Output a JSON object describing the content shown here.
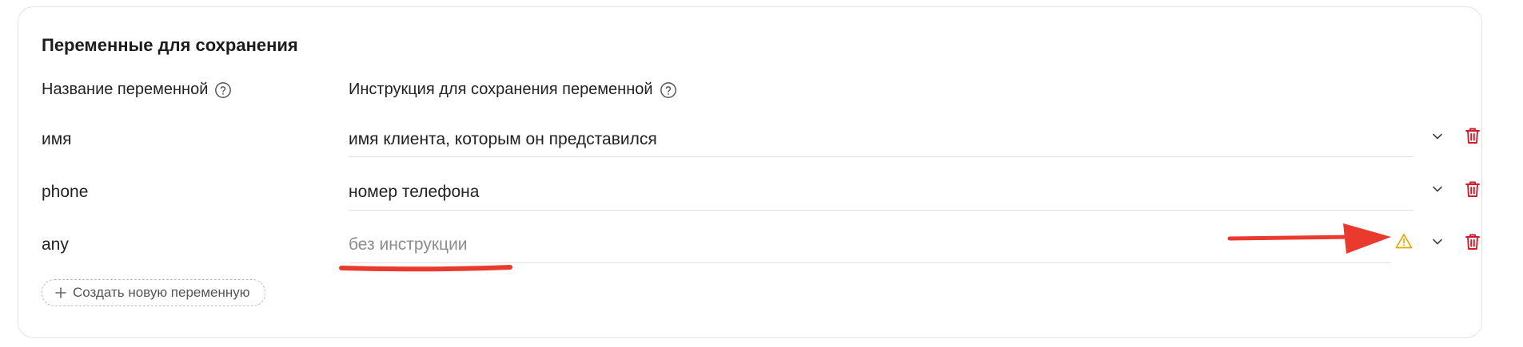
{
  "section": {
    "title": "Переменные для сохранения",
    "col_name_header": "Название переменной",
    "col_instruction_header": "Инструкция для сохранения переменной"
  },
  "variables": [
    {
      "name": "имя",
      "instruction": "имя клиента, которым он представился",
      "warning": false
    },
    {
      "name": "phone",
      "instruction": "номер телефона",
      "warning": false
    },
    {
      "name": "any",
      "instruction": "",
      "placeholder": "без инструкции",
      "warning": true
    }
  ],
  "add_button": {
    "label": "Создать новую переменную"
  },
  "colors": {
    "delete": "#d11a2a",
    "warning": "#e6a700",
    "annotation": "#ea3a2e"
  },
  "icons": [
    "help-circle-icon",
    "chevron-down-icon",
    "trash-icon",
    "warning-triangle-icon",
    "plus-icon"
  ]
}
